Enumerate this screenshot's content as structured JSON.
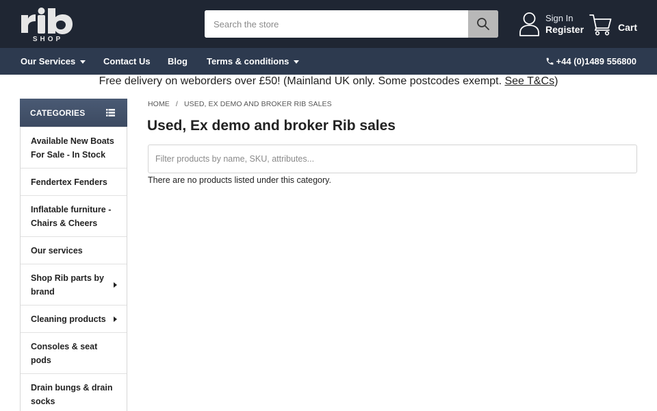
{
  "header": {
    "logo_text": "rib SHOP",
    "search_placeholder": "Search the store",
    "signin_label": "Sign In",
    "register_label": "Register",
    "cart_label": "Cart"
  },
  "nav": {
    "items": [
      {
        "label": "Our Services",
        "dropdown": true
      },
      {
        "label": "Contact Us",
        "dropdown": false
      },
      {
        "label": "Blog",
        "dropdown": false
      },
      {
        "label": "Terms & conditions",
        "dropdown": true
      }
    ],
    "phone": "+44 (0)1489 556800"
  },
  "banner": {
    "text": "Free delivery on weborders over £50! (Mainland UK only. Some postcodes exempt. ",
    "link_text": "See T&Cs",
    "suffix": ")"
  },
  "sidebar": {
    "title": "CATEGORIES",
    "items": [
      {
        "label": "Available New Boats For Sale - In Stock",
        "has_children": false
      },
      {
        "label": "Fendertex Fenders",
        "has_children": false
      },
      {
        "label": "Inflatable furniture - Chairs & Cheers",
        "has_children": false
      },
      {
        "label": "Our services",
        "has_children": false
      },
      {
        "label": "Shop Rib parts by brand",
        "has_children": true
      },
      {
        "label": "Cleaning products",
        "has_children": true
      },
      {
        "label": "Consoles & seat pods",
        "has_children": false
      },
      {
        "label": "Drain bungs & drain socks",
        "has_children": false
      }
    ]
  },
  "main": {
    "breadcrumb": [
      "HOME",
      "USED, EX DEMO AND BROKER RIB SALES"
    ],
    "title": "Used, Ex demo and broker Rib sales",
    "filter_placeholder": "Filter products by name, SKU, attributes...",
    "empty_message": "There are no products listed under this category."
  },
  "colors": {
    "header_bg": "#1f2633",
    "nav_bg": "#2d3a4f",
    "sidebar_head_bg": "#3c4a61",
    "search_button_bg": "#b8b8b8"
  }
}
